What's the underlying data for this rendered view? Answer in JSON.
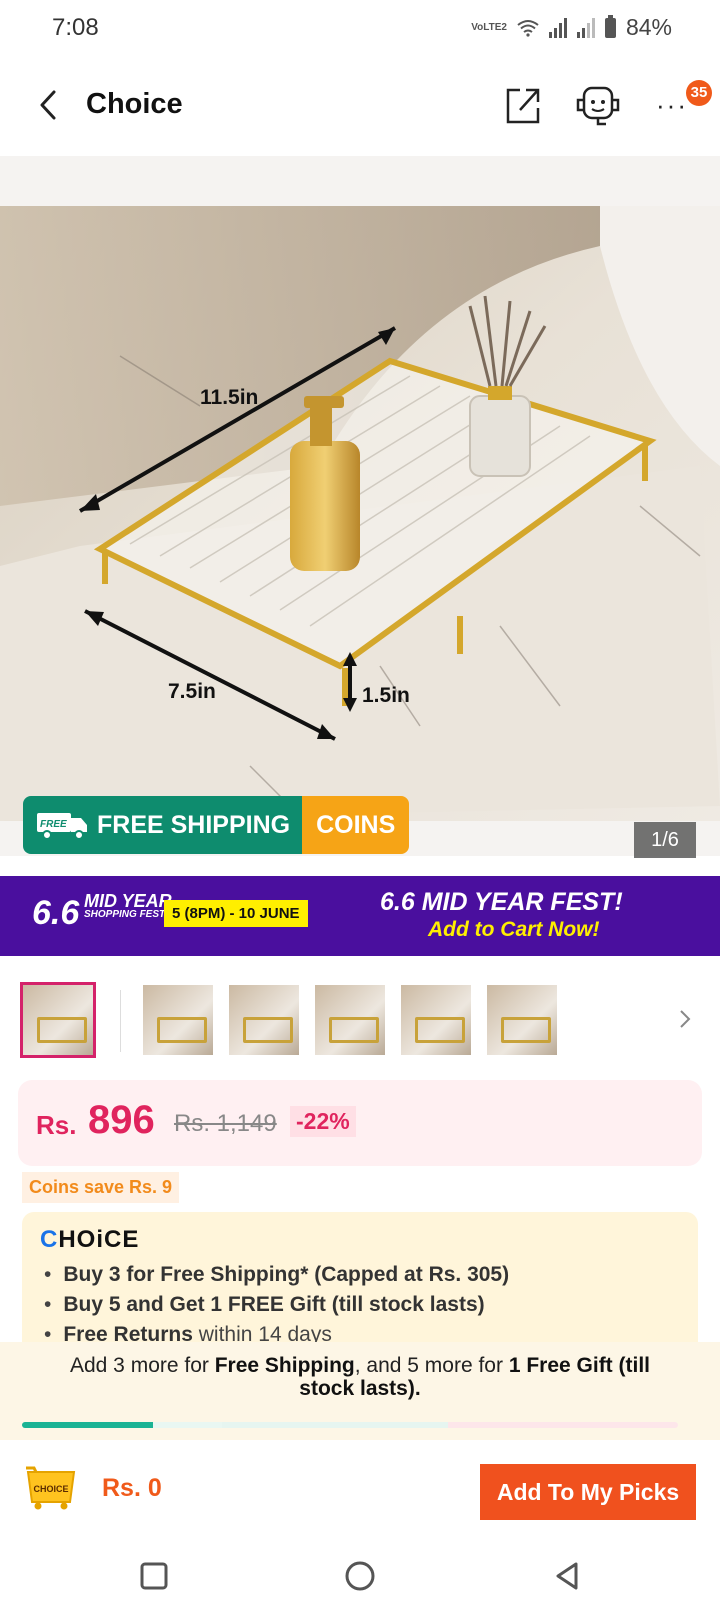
{
  "status_bar": {
    "time": "7:08",
    "network_label": "VoLTE2",
    "battery": "84%"
  },
  "header": {
    "title": "Choice",
    "notification_count": "35",
    "back_icon": "chevron-left-icon",
    "share_icon": "share-icon",
    "support_icon": "customer-service-icon",
    "more_icon": "more-dots-icon"
  },
  "gallery": {
    "dimensions": [
      "11.5in",
      "7.5in",
      "1.5in"
    ],
    "shipping_badge": {
      "icon_text": "FREE",
      "label": "FREE SHIPPING",
      "coins": "COINS"
    },
    "counter": "1/6",
    "thumbnail_count": 6
  },
  "promo": {
    "number": "6.6",
    "mid_year": "MID YEAR",
    "sub": "SHOPPING FEST!",
    "date": "5 (8PM) - 10 JUNE",
    "title": "6.6 MID YEAR FEST!",
    "cta": "Add to Cart Now!"
  },
  "price": {
    "currency": "Rs.",
    "current": "896",
    "original": "Rs. 1,149",
    "discount": "-22%"
  },
  "coins_save": "Coins save Rs. 9",
  "choice": {
    "logo_first": "C",
    "logo_rest": "HOiCE",
    "items": [
      {
        "bold": "Buy 3 for  Free Shipping* (Capped at Rs. 305)",
        "rest": ""
      },
      {
        "bold": "Buy 5 and Get 1 FREE Gift (till stock lasts)",
        "rest": ""
      },
      {
        "bold": "Free Returns",
        "rest": " within 14 days"
      }
    ]
  },
  "progress_note": {
    "p1": "Add 3 more for ",
    "b1": "Free Shipping",
    "p2": ", and 5 more for ",
    "b2": "1 Free Gift (till stock lasts)."
  },
  "progress": {
    "fraction": 0.2
  },
  "action_bar": {
    "cart_label": "CHOICE",
    "total": "Rs. 0",
    "button": "Add To My Picks"
  },
  "colors": {
    "brand_orange": "#f05a1a",
    "price_pink": "#e0245e",
    "shipping_green": "#0e8c6e",
    "coins_orange": "#f6a416",
    "promo_purple": "#4a0f9e"
  }
}
